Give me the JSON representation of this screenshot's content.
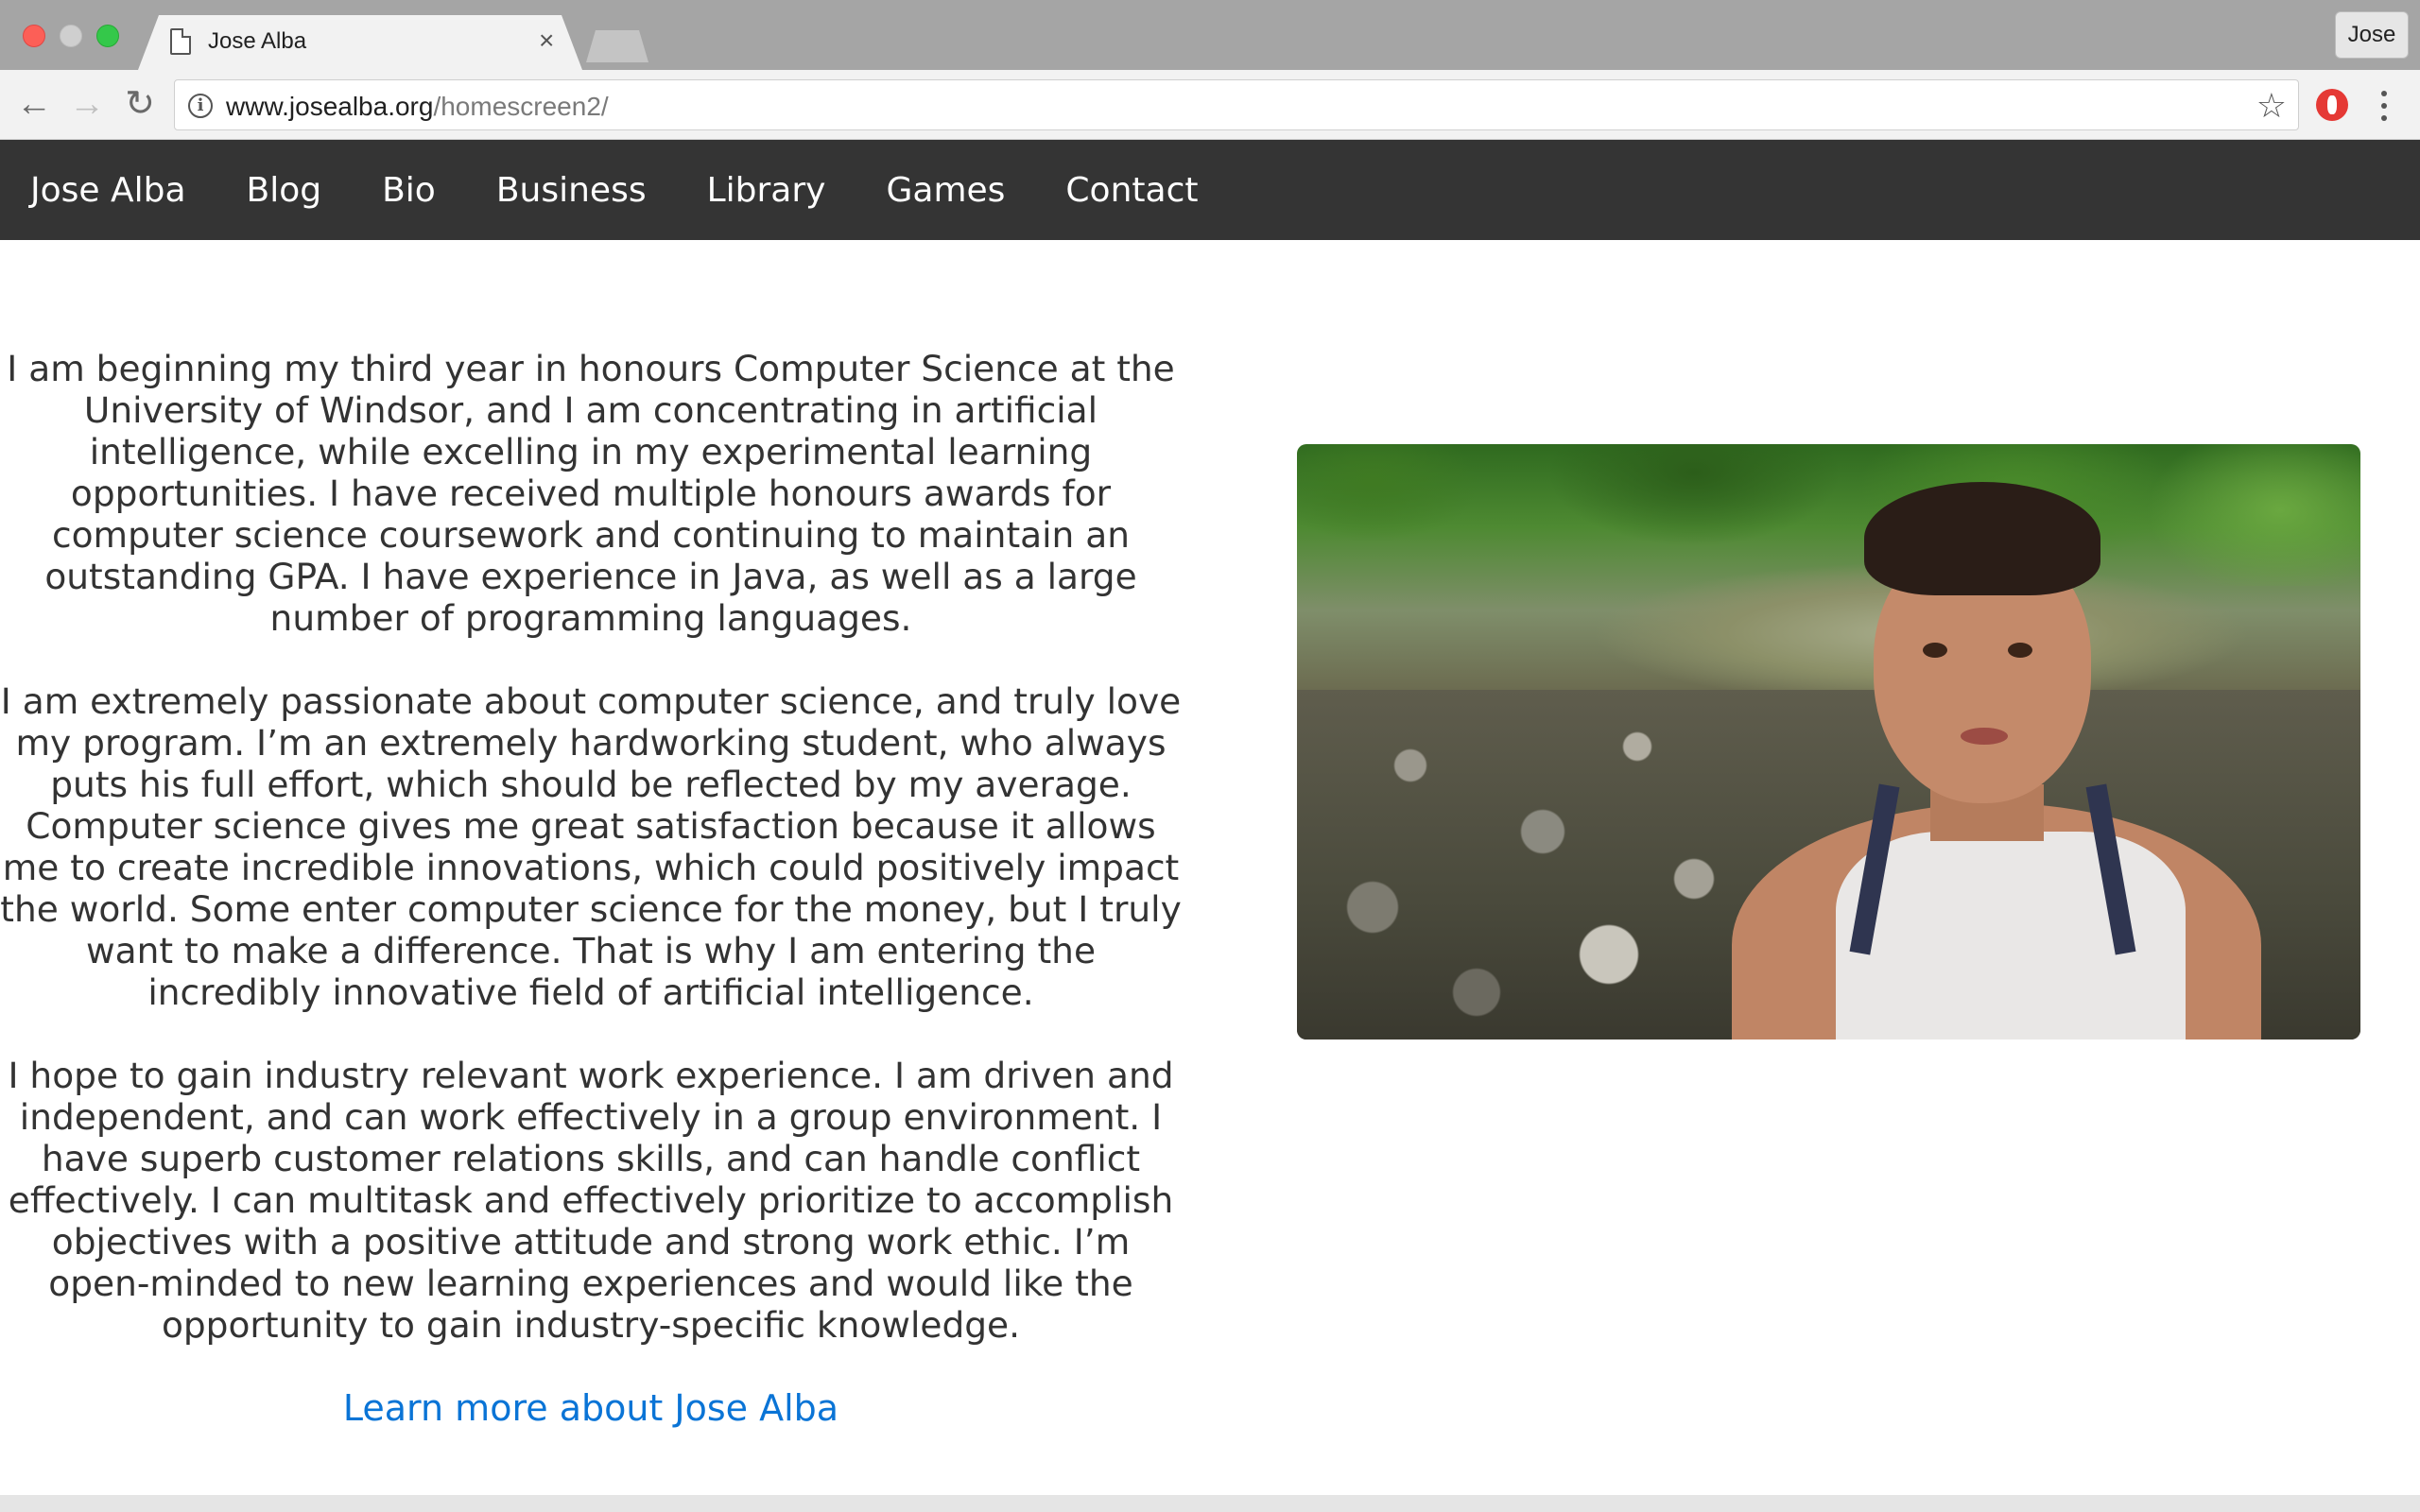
{
  "browser": {
    "tab_title": "Jose Alba",
    "tab_close": "×",
    "profile_label": "Jose",
    "url_host": "www.josealba.org",
    "url_path": "/homescreen2/"
  },
  "nav": {
    "brand": "Jose Alba",
    "items": [
      {
        "label": "Blog"
      },
      {
        "label": "Bio"
      },
      {
        "label": "Business"
      },
      {
        "label": "Library"
      },
      {
        "label": "Games"
      },
      {
        "label": "Contact"
      }
    ]
  },
  "bio": {
    "paragraphs": [
      "I am beginning my third year in honours Computer Science at the University of Windsor, and I am concentrating in artificial intelligence, while excelling in my experimental learning opportunities. I have received multiple honours awards for computer science coursework and continuing to maintain an outstanding GPA. I have experience in Java, as well as a large number of programming languages.",
      "I am extremely passionate about computer science, and truly love my program. I’m an extremely hardworking student, who always puts his full effort, which should be reflected by my average. Computer science gives me great satisfaction because it allows me to create incredible innovations, which could positively impact the world. Some enter computer science for the money, but I truly want to make a difference. That is why I am entering the incredibly innovative field of artificial intelligence.",
      "I hope to gain industry relevant work experience. I am driven and independent, and can work effectively in a group environment. I have superb customer relations skills, and can handle conflict effectively. I can multitask and effectively prioritize to accomplish objectives with a positive attitude and strong work ethic. I’m open-minded to new learning experiences and would like the opportunity to gain industry-specific knowledge."
    ],
    "learn_more": "Learn more about Jose Alba"
  },
  "colors": {
    "navbar_bg": "#343434",
    "link": "#0a74d6",
    "body_text": "#333333"
  }
}
